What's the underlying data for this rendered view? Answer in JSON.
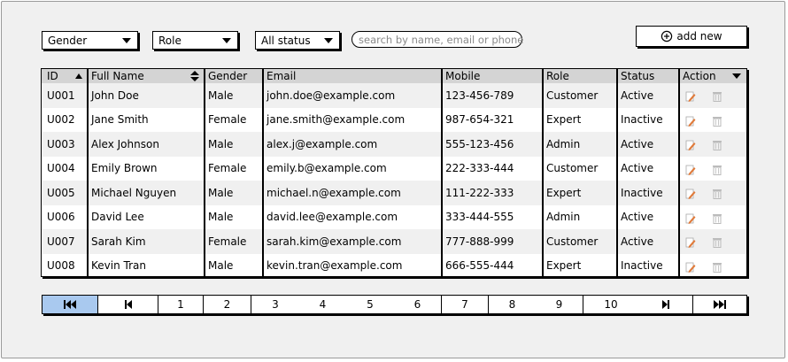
{
  "filters": {
    "gender": "Gender",
    "role": "Role",
    "status": "All status",
    "search_placeholder": "search by name, email or phone"
  },
  "add_button_label": "add new",
  "table": {
    "headers": {
      "id": "ID",
      "name": "Full Name",
      "gender": "Gender",
      "email": "Email",
      "mobile": "Mobile",
      "role": "Role",
      "status": "Status",
      "action": "Action"
    },
    "rows": [
      {
        "id": "U001",
        "name": "John Doe",
        "gender": "Male",
        "email": "john.doe@example.com",
        "mobile": "123-456-789",
        "role": "Customer",
        "status": "Active"
      },
      {
        "id": "U002",
        "name": "Jane Smith",
        "gender": "Female",
        "email": "jane.smith@example.com",
        "mobile": "987-654-321",
        "role": "Expert",
        "status": "Inactive"
      },
      {
        "id": "U003",
        "name": "Alex Johnson",
        "gender": "Male",
        "email": "alex.j@example.com",
        "mobile": "555-123-456",
        "role": "Admin",
        "status": "Active"
      },
      {
        "id": "U004",
        "name": "Emily Brown",
        "gender": "Female",
        "email": "emily.b@example.com",
        "mobile": "222-333-444",
        "role": "Customer",
        "status": "Active"
      },
      {
        "id": "U005",
        "name": "Michael Nguyen",
        "gender": "Male",
        "email": "michael.n@example.com",
        "mobile": "111-222-333",
        "role": "Expert",
        "status": "Inactive"
      },
      {
        "id": "U006",
        "name": "David Lee",
        "gender": "Male",
        "email": "david.lee@example.com",
        "mobile": "333-444-555",
        "role": "Admin",
        "status": "Active"
      },
      {
        "id": "U007",
        "name": "Sarah Kim",
        "gender": "Female",
        "email": "sarah.kim@example.com",
        "mobile": "777-888-999",
        "role": "Customer",
        "status": "Active"
      },
      {
        "id": "U008",
        "name": "Kevin Tran",
        "gender": "Male",
        "email": "kevin.tran@example.com",
        "mobile": "666-555-444",
        "role": "Expert",
        "status": "Inactive"
      }
    ]
  },
  "pagination": {
    "pages": [
      "1",
      "2",
      "3",
      "4",
      "5",
      "6",
      "7",
      "8",
      "9",
      "10"
    ],
    "active": "first"
  },
  "colors": {
    "pager_active": "#a9c9ef",
    "header_bg": "#d4d4d4",
    "alt_row": "#f0f0f0",
    "edit_icon": "#e07a3a"
  }
}
